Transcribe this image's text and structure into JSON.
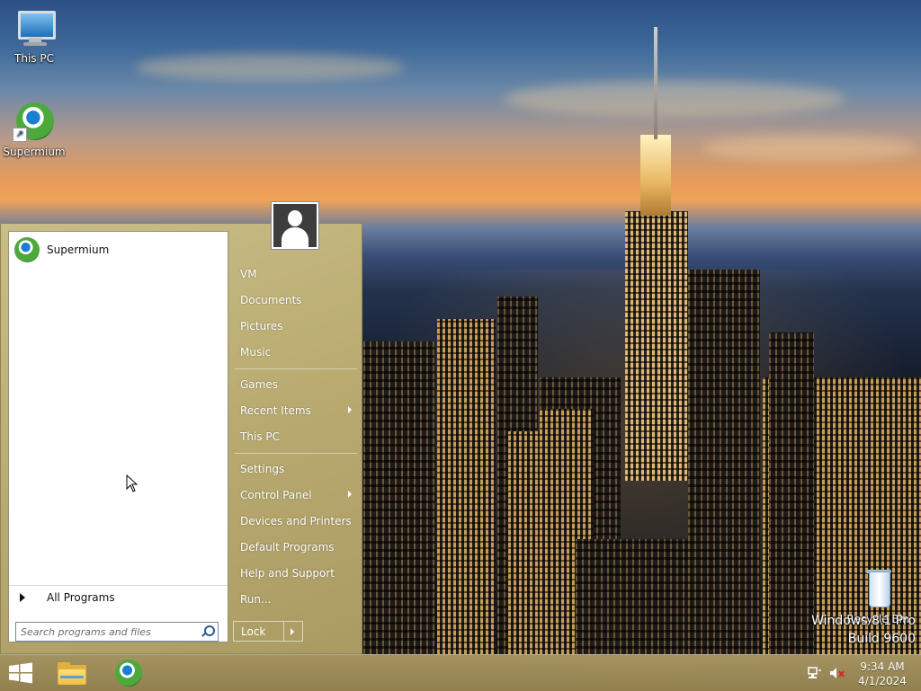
{
  "desktop": {
    "icons": [
      {
        "label": "This PC"
      },
      {
        "label": "Supermium"
      },
      {
        "label": "Recycle Bin"
      }
    ],
    "watermark": {
      "edition": "Windows 8.1 Pro",
      "build": "Build 9600"
    }
  },
  "start_menu": {
    "pinned": [
      {
        "label": "Supermium"
      }
    ],
    "all_programs_label": "All Programs",
    "search_placeholder": "Search programs and files",
    "right_items": [
      {
        "label": "VM"
      },
      {
        "label": "Documents"
      },
      {
        "label": "Pictures"
      },
      {
        "label": "Music"
      },
      {
        "label": "Games"
      },
      {
        "label": "Recent Items"
      },
      {
        "label": "This PC"
      },
      {
        "label": "Settings"
      },
      {
        "label": "Control Panel"
      },
      {
        "label": "Devices and Printers"
      },
      {
        "label": "Default Programs"
      },
      {
        "label": "Help and Support"
      },
      {
        "label": "Run..."
      }
    ],
    "lock_label": "Lock"
  },
  "taskbar": {
    "apps": [
      {
        "icon": "windows-logo-icon"
      },
      {
        "icon": "file-explorer-icon"
      },
      {
        "icon": "supermium-icon"
      }
    ],
    "tray_icons": [
      "network-icon",
      "volume-muted-icon"
    ],
    "clock": {
      "time": "9:34 AM",
      "date": "4/1/2024"
    }
  },
  "colors": {
    "start_menu_bg": "#b9ab70",
    "taskbar_bg": "#a89455",
    "text_light": "#ffffff"
  }
}
